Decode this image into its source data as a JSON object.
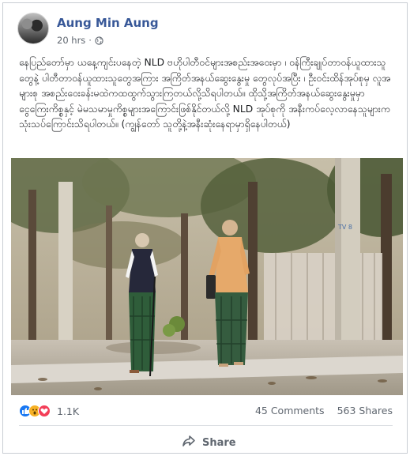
{
  "post": {
    "author": "Aung Min Aung",
    "time": "20 hrs",
    "separator": "·",
    "text": "နေပြည်တော်မှာ ယနေ့ကျင်းပနေတဲ့ NLD ဗဟိုပါတီဝင်များအစည်းအဝေးမှာ ၊ ဝန်ကြီးချုပ်တာဝန်ယူထားသူတွေနဲ့ ပါတီတာဝန်ယူထားသူတွေအကြား အကြိတ်အနယ်ဆွေးနွေးမှု တွေလုပ်အပြီး ၊ ဦးဝင်းထိန်အုပ်စုမှ လူအများစု အစည်းဝေးခန်းမထဲကထထွက်သွားကြတယ်လို့သိရပါတယ်။ ထိုသို့အကြိတ်အနယ်ဆွေးနွေးမှုမှာ ငွေကြေးကိစ္စနှင့် မဲမသမာမှုကိစ္စများအကြောင်းဖြစ်နိုင်တယ်လို့ NLD အုပ်စုကို အနီးကပ်လေ့လာနေသူများက သုံးသပ်ကြောင်းသိရပါတယ်။ (ကျွန်တော် သူတို့နဲ့အနီးဆုံးနေရာမှာရှိနေပါတယ်)"
  },
  "photo": {
    "sign_text": "TV 8"
  },
  "footer": {
    "reaction_count": "1.1K",
    "comments": "45 Comments",
    "shares": "563 Shares",
    "share_label": "Share"
  },
  "colors": {
    "author_link": "#385898",
    "like": "#1877f2",
    "wow": "#f7b125",
    "love": "#f33e58"
  },
  "icons": [
    "globe-icon",
    "like-reaction-icon",
    "wow-reaction-icon",
    "love-reaction-icon",
    "share-icon"
  ]
}
